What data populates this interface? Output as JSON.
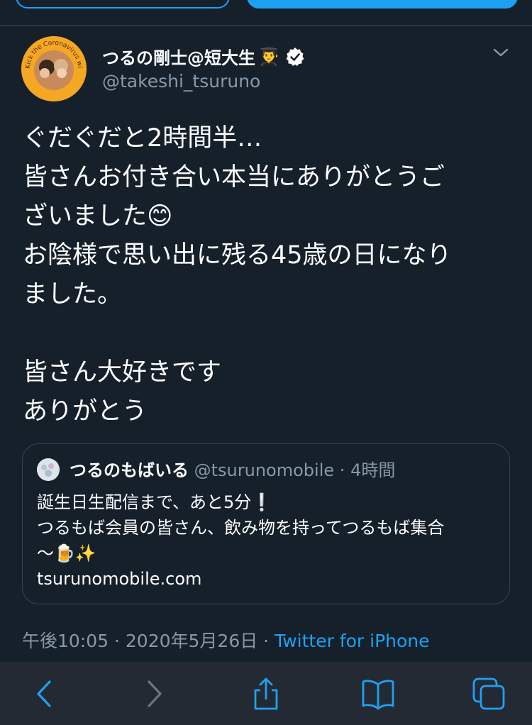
{
  "tweet": {
    "display_name": "つるの剛士@短大生",
    "name_emoji": "👨‍🎓",
    "handle": "@takeshi_tsuruno",
    "text": "ぐだぐだと2時間半…\n皆さんお付き合い本当にありがとうご\nざいました😊\nお陰様で思い出に残る45歳の日になり\nました。\n\n皆さん大好きです\nありがとう",
    "timestamp": "午後10:05 · 2020年5月26日 · ",
    "source": "Twitter for iPhone"
  },
  "quoted": {
    "name": "つるのもばいる",
    "handle": "@tsurunomobile",
    "separator": "·",
    "time": "4時間",
    "text": "誕生日生配信まで、あと5分❕\nつるもば会員の皆さん、飲み物を持ってつるもば集合\n〜🍺✨\ntsurunomobile.com"
  },
  "avatar_text": "Kick the Coronavirus with hands and smile",
  "colors": {
    "background": "#15202b",
    "accent": "#1da1f2",
    "secondary_text": "#8899a6",
    "border": "#38444d",
    "toolbar": "#242a33"
  },
  "toolbar_icons": [
    "back-icon",
    "forward-icon",
    "share-icon",
    "bookmarks-icon",
    "tabs-icon"
  ]
}
